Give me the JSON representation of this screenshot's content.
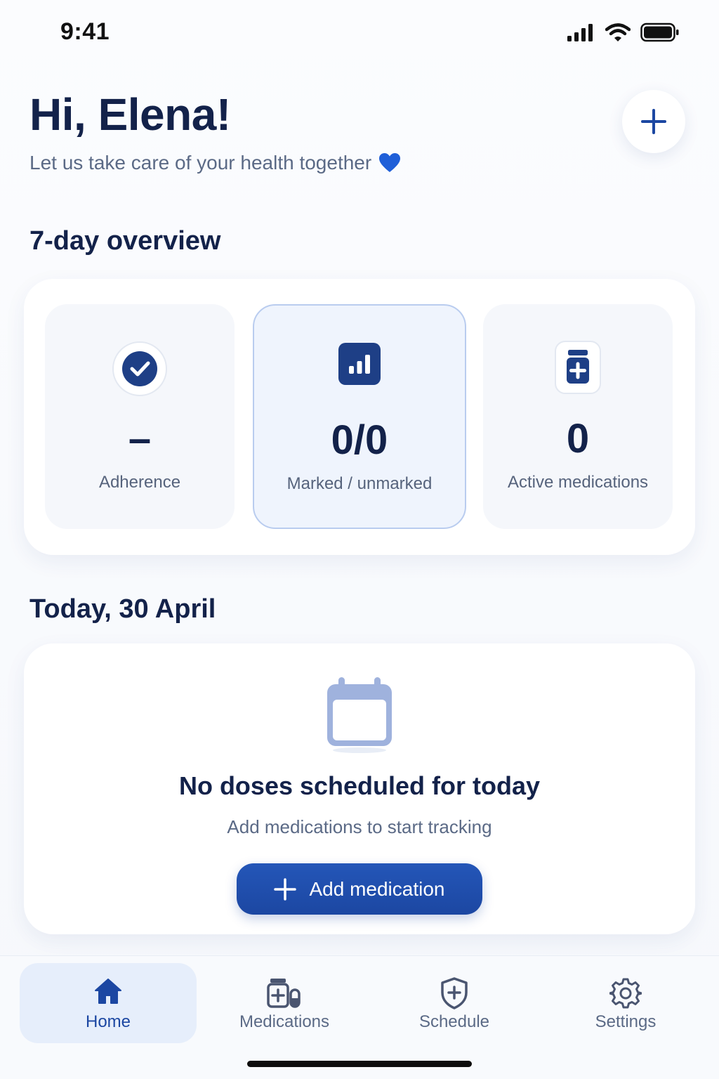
{
  "status_bar": {
    "time": "9:41",
    "icons": [
      "signal-icon",
      "wifi-icon",
      "battery-icon"
    ]
  },
  "header": {
    "greeting": "Hi, Elena!",
    "subtitle": "Let us take care of your health together",
    "subtitle_emoji": "blue-heart-icon",
    "add_button_icon": "plus-icon"
  },
  "overview": {
    "title": "7-day overview",
    "stats": [
      {
        "icon": "check-circle-icon",
        "value": "–",
        "label": "Adherence"
      },
      {
        "icon": "bar-chart-icon",
        "value": "0/0",
        "label": "Marked / unmarked"
      },
      {
        "icon": "medicine-bottle-icon",
        "value": "0",
        "label": "Active medications"
      }
    ]
  },
  "today": {
    "title": "Today, 30 April",
    "empty_icon": "calendar-icon",
    "empty_title": "No doses scheduled for today",
    "empty_subtitle": "Add medications to start tracking",
    "add_button_label": "Add medication"
  },
  "tabs": [
    {
      "icon": "home-icon",
      "label": "Home",
      "active": true
    },
    {
      "icon": "medications-icon",
      "label": "Medications",
      "active": false
    },
    {
      "icon": "shield-plus-icon",
      "label": "Schedule",
      "active": false
    },
    {
      "icon": "gear-icon",
      "label": "Settings",
      "active": false
    }
  ],
  "colors": {
    "primary": "#1c47a2",
    "navy_text": "#13224a",
    "muted_text": "#5b6a86",
    "card_bg": "#ffffff",
    "stat_bg": "#f5f7fb",
    "active_tab_bg": "#e6eefb",
    "calendar_tint": "#9fb2dd"
  }
}
